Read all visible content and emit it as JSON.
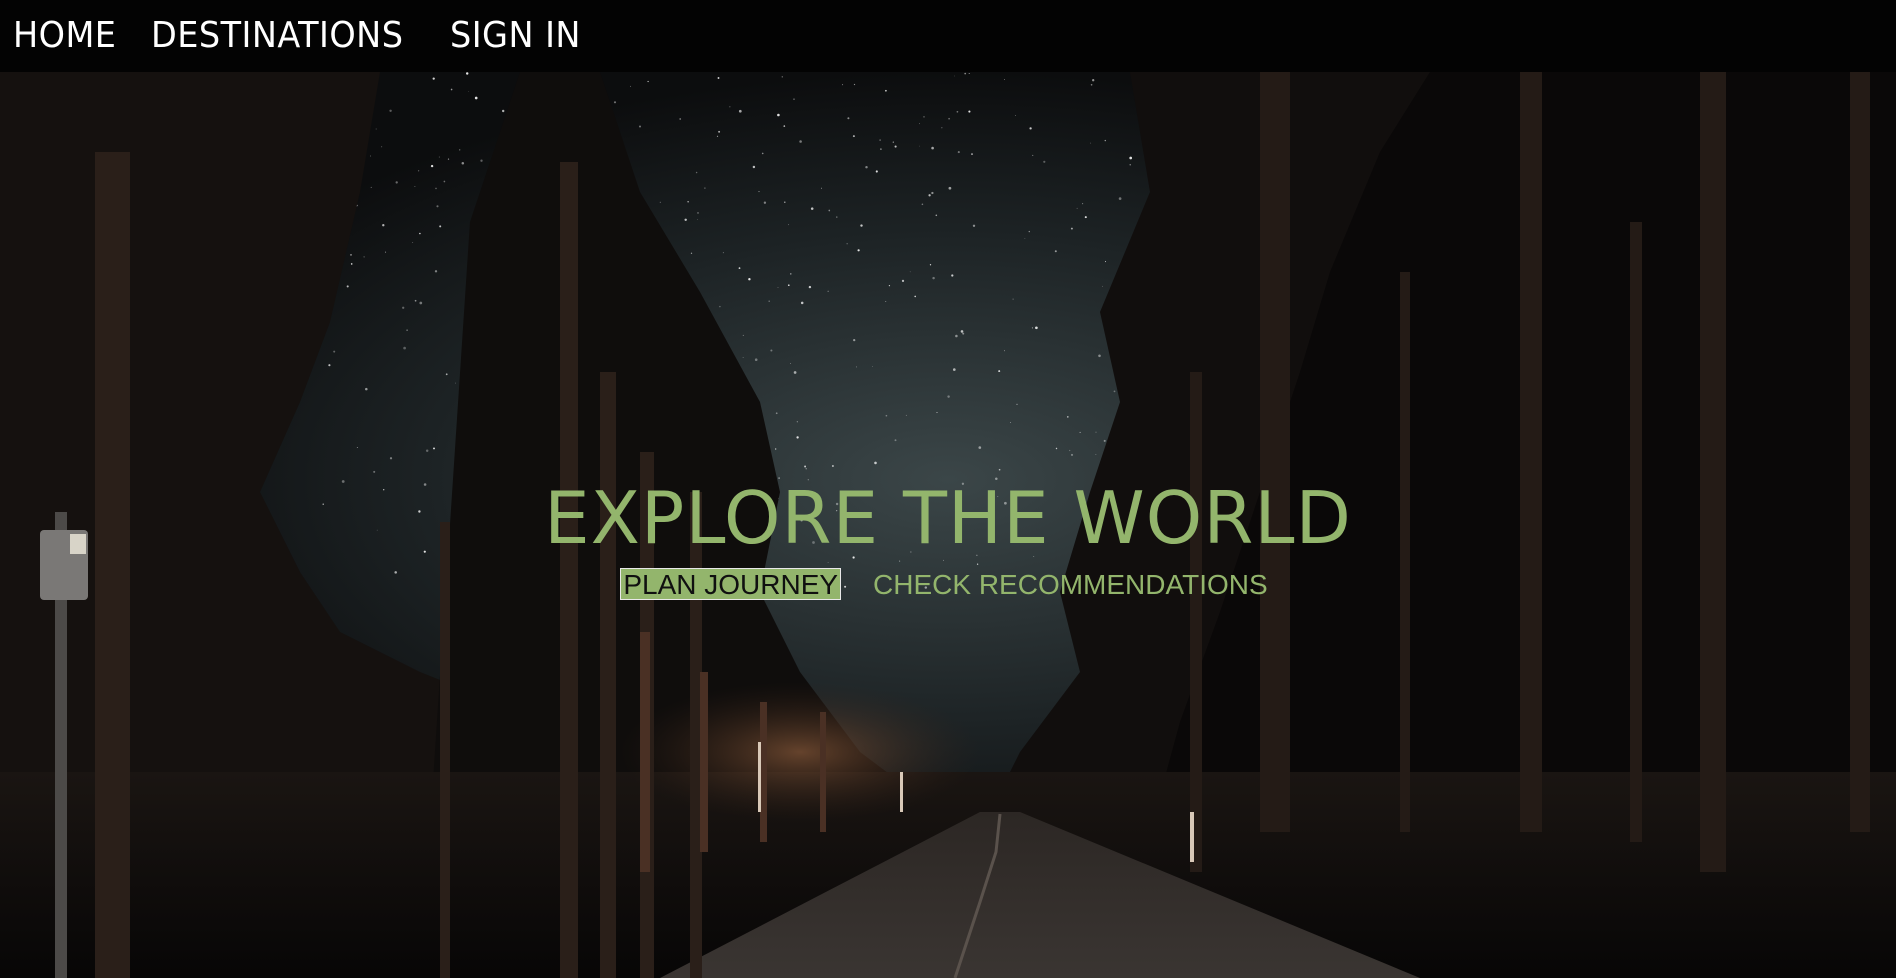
{
  "nav": {
    "items": [
      {
        "label": "HOME"
      },
      {
        "label": "DESTINATIONS"
      },
      {
        "label": "SIGN IN"
      }
    ]
  },
  "hero": {
    "title": "EXPLORE THE WORLD",
    "primary_button": "PLAN JOURNEY",
    "secondary_button": "CHECK RECOMMENDATIONS",
    "background": "night-forest-road-starry-sky-photo"
  },
  "colors": {
    "accent": "#93b56c",
    "nav_background": "#030303",
    "nav_text": "#ffffff"
  }
}
